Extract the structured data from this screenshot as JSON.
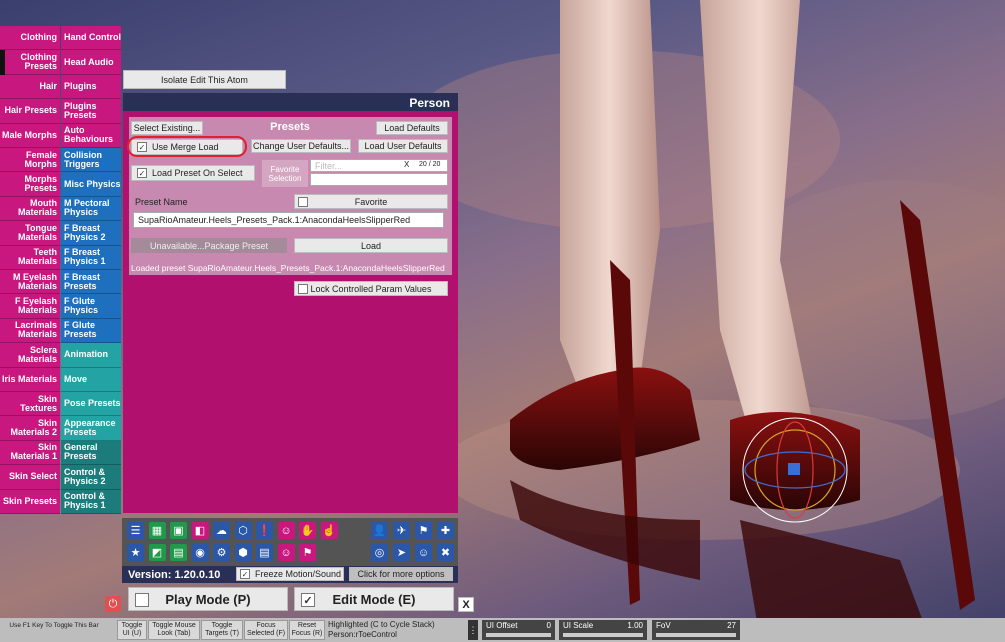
{
  "left_tabs": [
    {
      "l": "Clothing",
      "r": "Hand Control",
      "rc": "mag"
    },
    {
      "l": "Clothing Presets",
      "r": "Head Audio",
      "rc": "mag"
    },
    {
      "l": "Hair",
      "r": "Plugins",
      "rc": "mag"
    },
    {
      "l": "Hair Presets",
      "r": "Plugins Presets",
      "rc": "mag"
    },
    {
      "l": "Male Morphs",
      "r": "Auto Behaviours",
      "rc": "mag"
    },
    {
      "l": "Female Morphs",
      "r": "Collision Triggers",
      "rc": "blu"
    },
    {
      "l": "Morphs Presets",
      "r": "Misc Physics",
      "rc": "blu"
    },
    {
      "l": "Mouth Materials",
      "r": "M Pectoral Physics",
      "rc": "blu"
    },
    {
      "l": "Tongue Materials",
      "r": "F Breast Physics 2",
      "rc": "blu"
    },
    {
      "l": "Teeth Materials",
      "r": "F Breast Physics 1",
      "rc": "blu"
    },
    {
      "l": "M Eyelash Materials",
      "r": "F Breast Presets",
      "rc": "blu"
    },
    {
      "l": "F Eyelash Materials",
      "r": "F Glute Physics",
      "rc": "blu"
    },
    {
      "l": "Lacrimals Materials",
      "r": "F Glute Presets",
      "rc": "blu"
    },
    {
      "l": "Sclera Materials",
      "r": "Animation",
      "rc": "tea"
    },
    {
      "l": "Iris Materials",
      "r": "Move",
      "rc": "tea"
    },
    {
      "l": "Skin Textures",
      "r": "Pose Presets",
      "rc": "tea"
    },
    {
      "l": "Skin Materials 2",
      "r": "Appearance Presets",
      "rc": "tea"
    },
    {
      "l": "Skin Materials 1",
      "r": "General Presets",
      "rc": "dtea"
    },
    {
      "l": "Skin Select",
      "r": "Control & Physics 2",
      "rc": "dtea"
    },
    {
      "l": "Skin Presets",
      "r": "Control & Physics 1",
      "rc": "dtea"
    }
  ],
  "isolate_button": "Isolate Edit This Atom",
  "panel": {
    "title": "Person",
    "select_existing": "Select Existing...",
    "presets_title": "Presets",
    "load_defaults": "Load Defaults",
    "use_merge_load": "Use Merge Load",
    "change_user_defaults": "Change User Defaults...",
    "load_user_defaults": "Load User Defaults",
    "load_preset_on_select": "Load Preset On Select",
    "favorite_selection": "Favorite Selection",
    "filter_placeholder": "Filter...",
    "filter_clear": "X",
    "filter_count": "20 / 20",
    "preset_name_label": "Preset Name",
    "favorite": "Favorite",
    "preset_name_value": "SupaRioAmateur.Heels_Presets_Pack.1:AnacondaHeelsSlipperRed",
    "unavailable": "Unavailable...Package Preset",
    "load": "Load",
    "loaded_msg": "Loaded preset SupaRioAmateur.Heels_Presets_Pack.1:AnacondaHeelsSlipperRed",
    "lock_params": "Lock Controlled Param Values"
  },
  "toolbar": {
    "version": "Version: 1.20.0.10",
    "freeze": "Freeze Motion/Sound",
    "more_options": "Click for more options",
    "play_mode": "Play Mode (P)",
    "edit_mode": "Edit Mode (E)",
    "close": "X"
  },
  "bottom": {
    "f1_hint": "Use F1 Key To Toggle This Bar",
    "toggle_ui": "Toggle UI (U)",
    "toggle_mouse": "Toggle Mouse Look (Tab)",
    "toggle_targets": "Toggle Targets (T)",
    "focus_selected": "Focus Selected (F)",
    "reset_focus": "Reset Focus (R)",
    "highlighted": "Highlighted (C to Cycle Stack)",
    "highlighted_target": "Person:rToeControl",
    "ui_offset_label": "UI Offset",
    "ui_offset_value": "0",
    "ui_scale_label": "UI Scale",
    "ui_scale_value": "1.00",
    "fov_label": "FoV",
    "fov_value": "27"
  },
  "colors": {
    "accent": "#c8187f",
    "blue": "#1f6fbf",
    "teal": "#23a3a3",
    "panel": "#b2106e",
    "header": "#2a2f55"
  }
}
